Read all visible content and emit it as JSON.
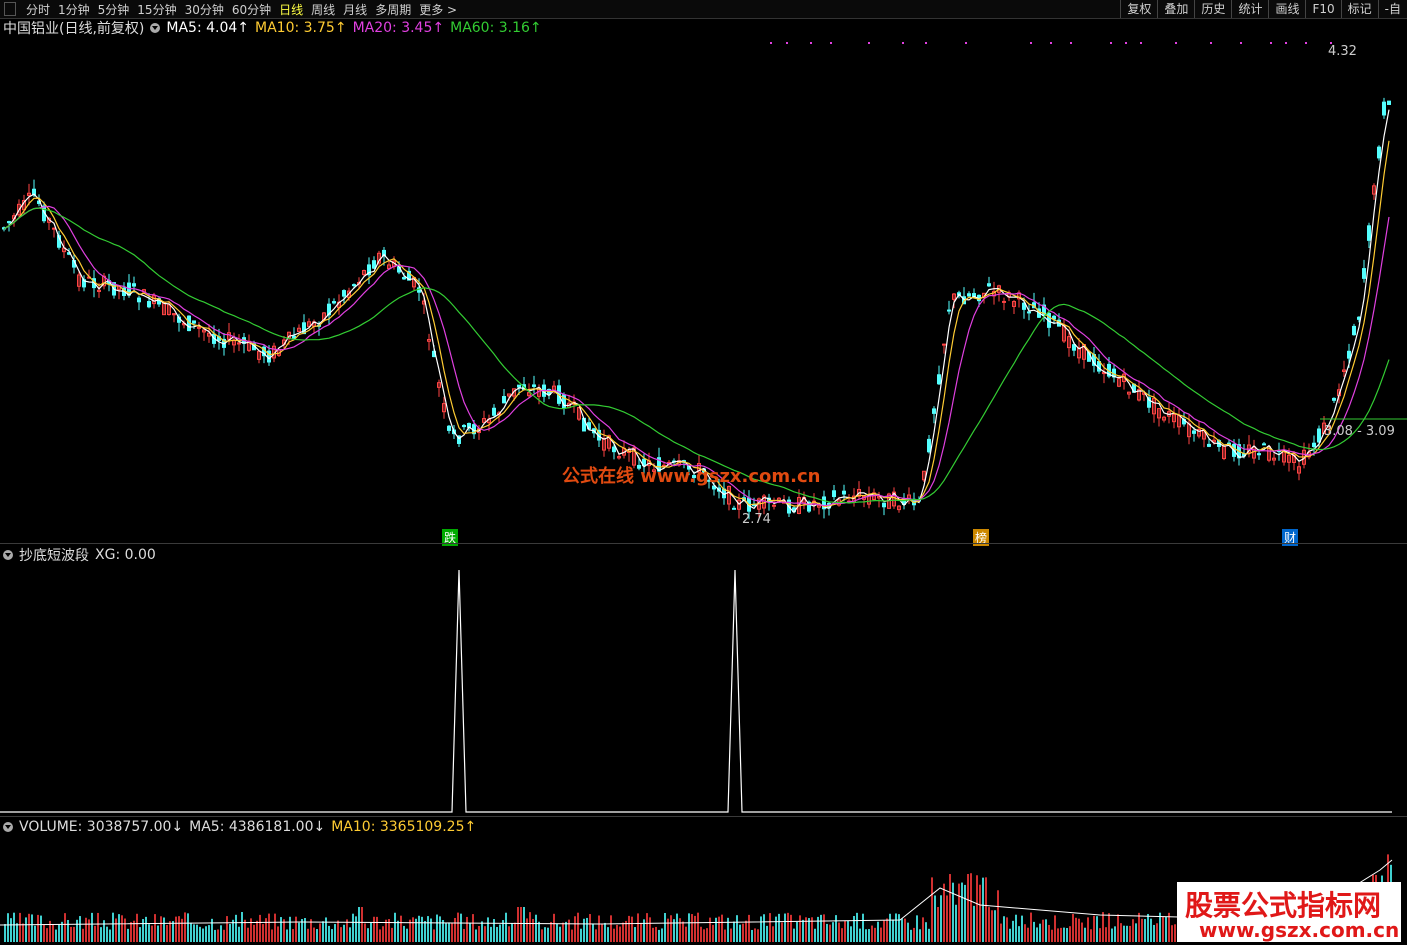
{
  "toolbar": {
    "periods": [
      "分时",
      "1分钟",
      "5分钟",
      "15分钟",
      "30分钟",
      "60分钟",
      "日线",
      "周线",
      "月线",
      "多周期",
      "更多 >"
    ],
    "active_period": "日线",
    "buttons": [
      "复权",
      "叠加",
      "历史",
      "统计",
      "画线",
      "F10",
      "标记",
      "-自"
    ]
  },
  "main_panel": {
    "stock_name": "中国铝业(日线,前复权)",
    "ma5": "MA5: 4.04↑",
    "ma10": "MA10: 3.75↑",
    "ma20": "MA20: 3.45↑",
    "ma60": "MA60: 3.16↑",
    "colors": {
      "ma5": "#ffffff",
      "ma10": "#ffcc33",
      "ma20": "#e040e0",
      "ma60": "#33cc33",
      "up": "#ff4444",
      "down": "#54ffff"
    },
    "high_label": "4.32",
    "low_label": "2.74",
    "range_label": "3.08 - 3.09",
    "event_marks": [
      "跌",
      "榜",
      "财"
    ],
    "watermark": "公式在线 www.gszx.com.cn"
  },
  "indicator_panel": {
    "title": "抄底短波段",
    "value": "XG: 0.00"
  },
  "volume_panel": {
    "volume": "VOLUME: 3038757.00↓",
    "ma5": "MA5: 4386181.00↓",
    "ma10": "MA10: 3365109.25↑",
    "logo_line1": "股票公式指标网",
    "logo_line2": "www.gszx.com.cn"
  }
}
